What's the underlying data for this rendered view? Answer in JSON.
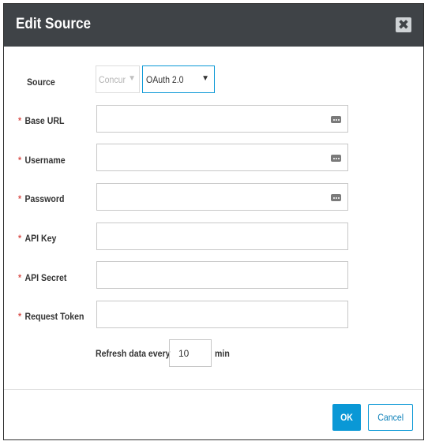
{
  "dialog": {
    "title": "Edit Source",
    "close_glyph": "✖"
  },
  "source": {
    "label": "Source",
    "type_value": "Concur",
    "auth_value": "OAuth 2.0",
    "arrow": "▼"
  },
  "fields": {
    "required_marker": "*",
    "base_url_label": "Base URL",
    "username_label": "Username",
    "password_label": "Password",
    "api_key_label": "API Key",
    "api_secret_label": "API Secret",
    "request_token_label": "Request Token"
  },
  "refresh": {
    "label": "Refresh data every",
    "value": "10",
    "unit": "min"
  },
  "buttons": {
    "ok": "OK",
    "cancel": "Cancel"
  },
  "icons": {
    "field_menu": "ellipsis-box-icon",
    "close": "close-icon"
  },
  "colors": {
    "titlebar": "#3f4347",
    "accent": "#0a98d6",
    "required": "#d9534f"
  }
}
